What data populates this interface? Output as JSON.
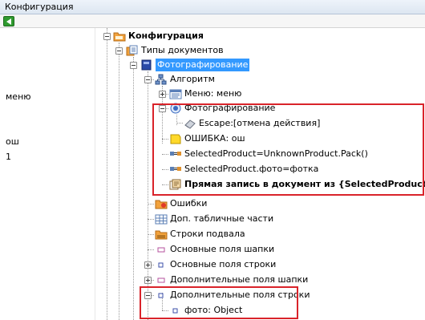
{
  "window": {
    "title": "Конфигурация"
  },
  "left_panel": {
    "lines": [
      "меню",
      "ош",
      "1"
    ]
  },
  "tree": {
    "rows": [
      {
        "label": "Конфигурация",
        "icon": "folder-config-icon"
      },
      {
        "label": "Типы документов",
        "icon": "doc-types-icon"
      },
      {
        "label": "Фотографирование",
        "icon": "document-book-icon"
      },
      {
        "label": "Алгоритм",
        "icon": "algorithm-icon"
      },
      {
        "label": "Меню: меню",
        "icon": "menu-icon"
      },
      {
        "label": "Фотографирование",
        "icon": "camera-disc-icon"
      },
      {
        "label": "Escape:[отмена действия]",
        "icon": "eraser-icon"
      },
      {
        "label": "ОШИБКА: ош",
        "icon": "note-icon"
      },
      {
        "label": "SelectedProduct=UnknownProduct.Pack()",
        "icon": "assign-icon"
      },
      {
        "label": "SelectedProduct.фото=фотка",
        "icon": "assign-icon"
      },
      {
        "label": "Прямая запись в документ из {SelectedProduct}",
        "icon": "write-doc-icon"
      },
      {
        "label": "Ошибки",
        "icon": "errors-folder-icon"
      },
      {
        "label": "Доп. табличные части",
        "icon": "table-parts-icon"
      },
      {
        "label": "Строки подвала",
        "icon": "footer-rows-icon"
      },
      {
        "label": "Основные поля шапки",
        "icon": "header-field-icon"
      },
      {
        "label": "Основные поля строки",
        "icon": "row-field-icon"
      },
      {
        "label": "Дополнительные поля шапки",
        "icon": "header-field-icon"
      },
      {
        "label": "Дополнительные поля строки",
        "icon": "row-field-icon"
      },
      {
        "label": "фото: Object",
        "icon": "field-icon"
      }
    ]
  },
  "colors": {
    "selection": "#3399ff",
    "highlight_box": "#d9232a"
  }
}
